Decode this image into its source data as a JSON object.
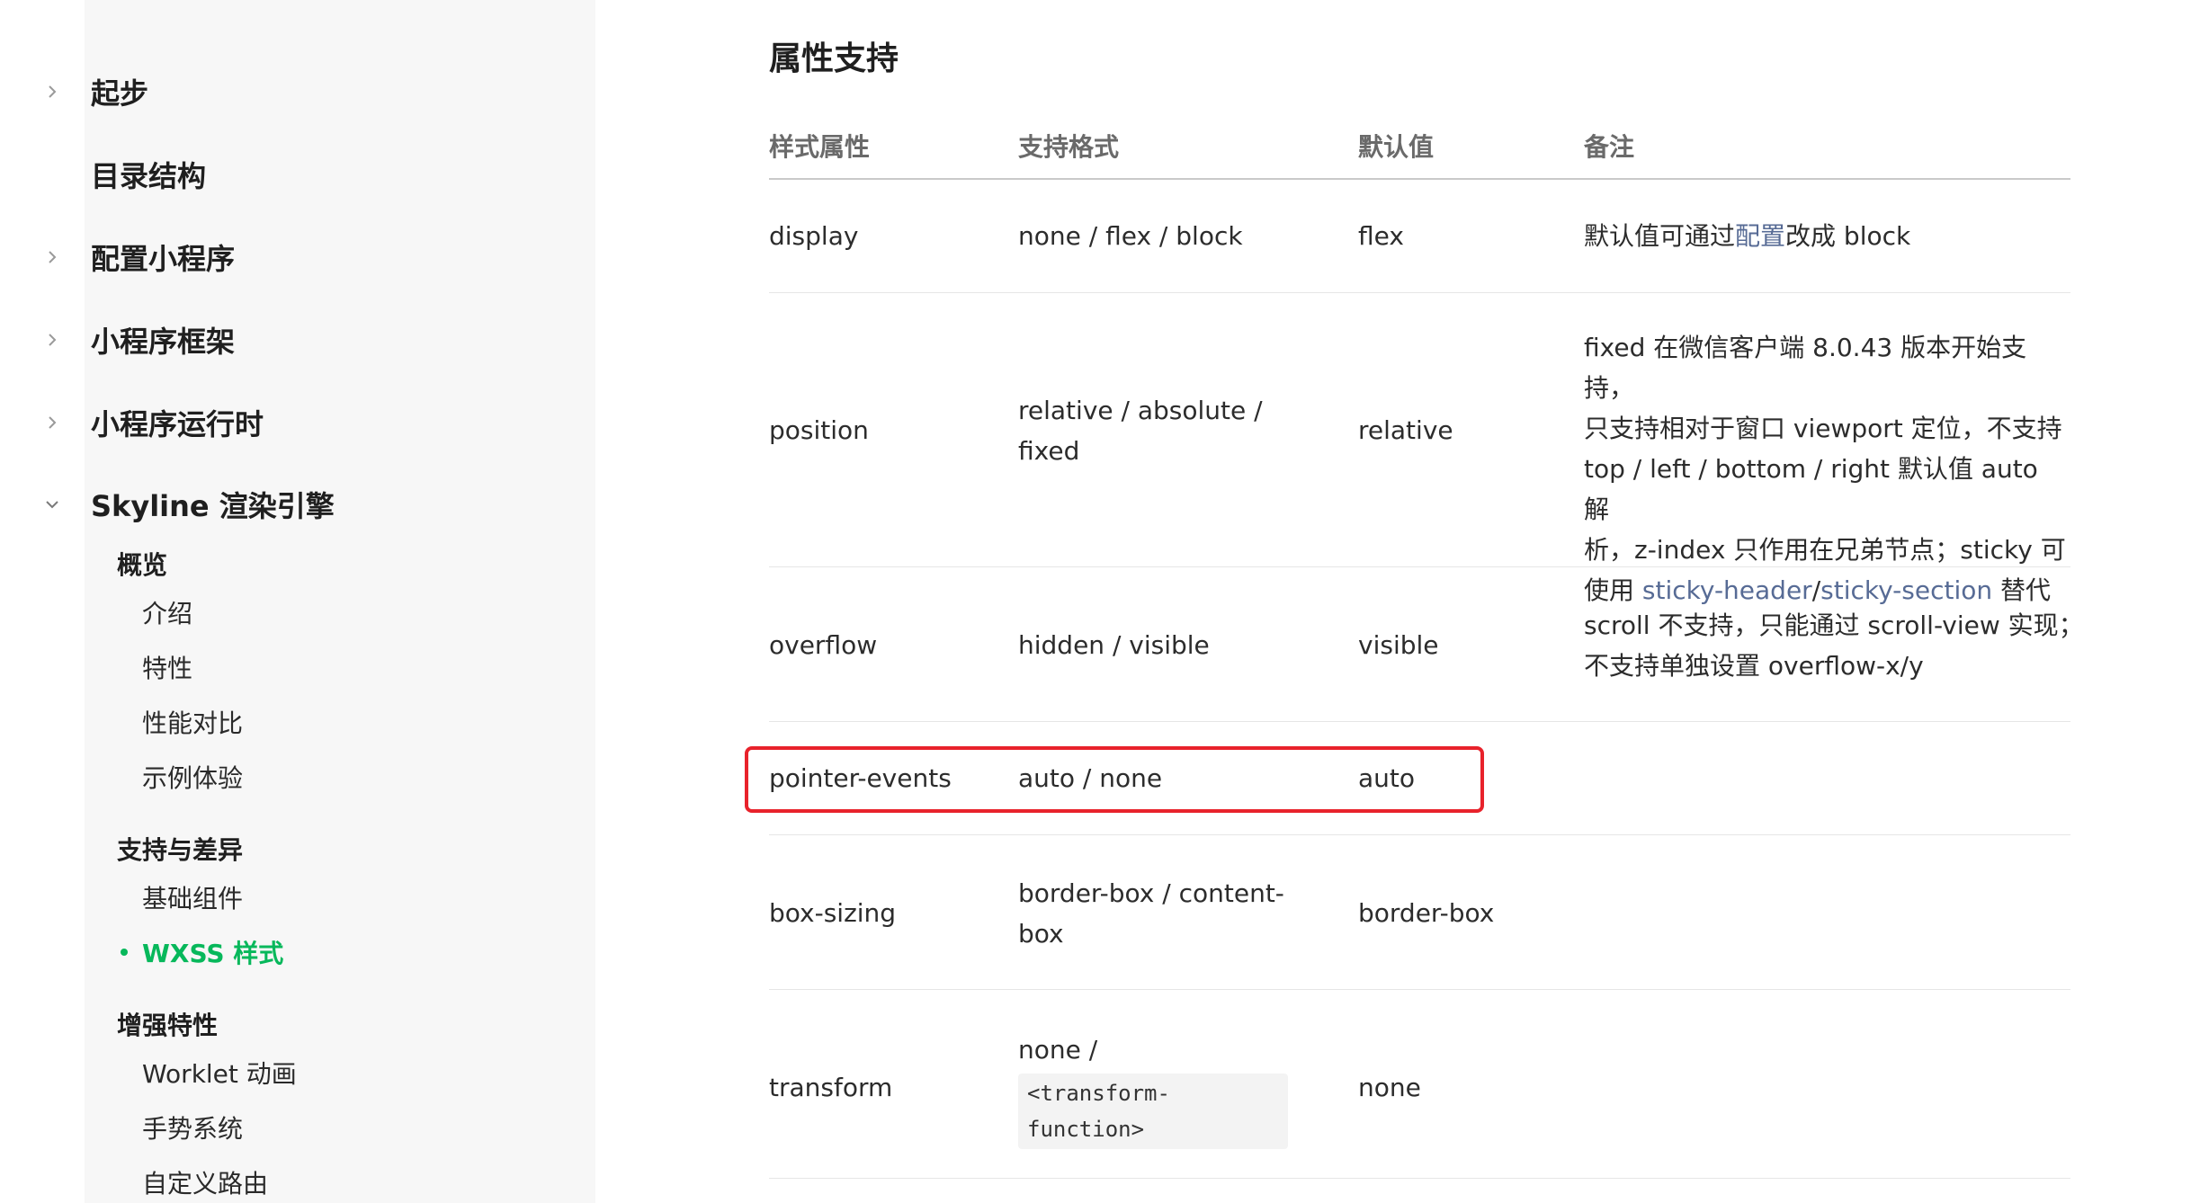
{
  "sidebar": {
    "top_items": [
      {
        "label": "起步",
        "has_chevron": true,
        "expanded": false
      },
      {
        "label": "目录结构",
        "has_chevron": false
      },
      {
        "label": "配置小程序",
        "has_chevron": true,
        "expanded": false
      },
      {
        "label": "小程序框架",
        "has_chevron": true,
        "expanded": false
      },
      {
        "label": "小程序运行时",
        "has_chevron": true,
        "expanded": false
      },
      {
        "label": "Skyline 渲染引擎",
        "has_chevron": true,
        "expanded": true
      }
    ],
    "groups": [
      {
        "label": "概览",
        "items": [
          "介绍",
          "特性",
          "性能对比",
          "示例体验"
        ]
      },
      {
        "label": "支持与差异",
        "items": [
          "基础组件",
          "WXSS 样式"
        ]
      },
      {
        "label": "增强特性",
        "items": [
          "Worklet 动画",
          "手势系统",
          "自定义路由"
        ]
      }
    ],
    "active_item": "WXSS 样式",
    "active_color": "#07b85b"
  },
  "content": {
    "title": "属性支持",
    "headers": [
      "样式属性",
      "支持格式",
      "默认值",
      "备注"
    ],
    "rows": [
      {
        "property": "display",
        "formats": "none / flex / block",
        "default": "flex",
        "note_parts": [
          "默认值可通过",
          "配置",
          "改成 block"
        ]
      },
      {
        "property": "position",
        "formats_lines": [
          "relative / absolute /",
          "fixed"
        ],
        "default": "relative",
        "note_lines": [
          "fixed 在微信客户端 8.0.43 版本开始支持，",
          "只支持相对于窗口 viewport 定位，不支持",
          "top / left / bottom / right 默认值 auto 解",
          "析，z-index 只作用在兄弟节点；sticky 可"
        ],
        "note_last": {
          "prefix": "使用 ",
          "link1": "sticky-header",
          "sep": "/",
          "link2": "sticky-section",
          "suffix": " 替代"
        }
      },
      {
        "property": "overflow",
        "formats": "hidden / visible",
        "default": "visible",
        "note_lines": [
          "scroll 不支持，只能通过 scroll-view 实现；",
          "不支持单独设置 overflow-x/y"
        ]
      },
      {
        "property": "pointer-events",
        "formats": "auto / none",
        "default": "auto",
        "note": "",
        "highlighted": true
      },
      {
        "property": "box-sizing",
        "formats_lines": [
          "border-box / content-",
          "box"
        ],
        "default": "border-box",
        "note": ""
      },
      {
        "property": "transform",
        "formats_prefix": "none /",
        "formats_code": "<transform-function>",
        "default": "none",
        "note": ""
      }
    ],
    "link_color": "#576b95",
    "highlight_color": "#e8222b"
  }
}
